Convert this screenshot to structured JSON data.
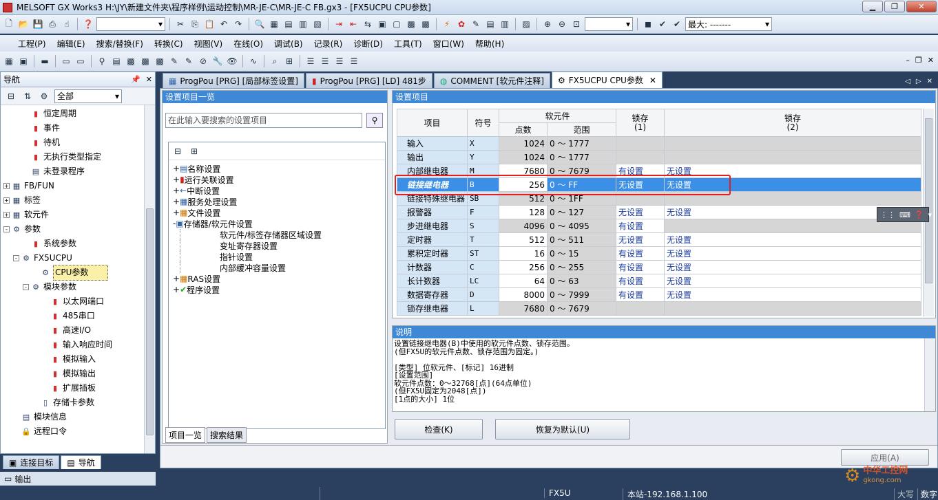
{
  "window": {
    "title": "MELSOFT GX Works3 H:\\JY\\新建文件夹\\程序样例\\运动控制\\MR-JE-C\\MR-JE-C FB.gx3 - [FX5UCPU CPU参数]"
  },
  "toolbar": {
    "max_label": "最大: -------"
  },
  "menu": [
    "工程(P)",
    "编辑(E)",
    "搜索/替换(F)",
    "转换(C)",
    "视图(V)",
    "在线(O)",
    "调试(B)",
    "记录(R)",
    "诊断(D)",
    "工具(T)",
    "窗口(W)",
    "帮助(H)"
  ],
  "nav": {
    "title": "导航",
    "filter": "全部",
    "items": [
      {
        "label": "恒定周期",
        "indent": 2,
        "exp": ""
      },
      {
        "label": "事件",
        "indent": 2,
        "exp": ""
      },
      {
        "label": "待机",
        "indent": 2,
        "exp": ""
      },
      {
        "label": "无执行类型指定",
        "indent": 2,
        "exp": ""
      },
      {
        "label": "未登录程序",
        "indent": 2,
        "exp": ""
      },
      {
        "label": "FB/FUN",
        "indent": 0,
        "exp": "+"
      },
      {
        "label": "标签",
        "indent": 0,
        "exp": "+"
      },
      {
        "label": "软元件",
        "indent": 0,
        "exp": "+"
      },
      {
        "label": "参数",
        "indent": 0,
        "exp": "-"
      },
      {
        "label": "系统参数",
        "indent": 2,
        "exp": ""
      },
      {
        "label": "FX5UCPU",
        "indent": 1,
        "exp": "-"
      },
      {
        "label": "CPU参数",
        "indent": 3,
        "exp": "",
        "selected": true
      },
      {
        "label": "模块参数",
        "indent": 2,
        "exp": "-"
      },
      {
        "label": "以太网端口",
        "indent": 4,
        "exp": ""
      },
      {
        "label": "485串口",
        "indent": 4,
        "exp": ""
      },
      {
        "label": "高速I/O",
        "indent": 4,
        "exp": ""
      },
      {
        "label": "输入响应时间",
        "indent": 4,
        "exp": ""
      },
      {
        "label": "模拟输入",
        "indent": 4,
        "exp": ""
      },
      {
        "label": "模拟输出",
        "indent": 4,
        "exp": ""
      },
      {
        "label": "扩展插板",
        "indent": 4,
        "exp": ""
      },
      {
        "label": "存储卡参数",
        "indent": 3,
        "exp": ""
      },
      {
        "label": "模块信息",
        "indent": 1,
        "exp": ""
      },
      {
        "label": "远程口令",
        "indent": 1,
        "exp": ""
      }
    ],
    "bottom_tabs": [
      "连接目标",
      "导航"
    ],
    "output": "输出"
  },
  "tabs": [
    "ProgPou [PRG] [局部标签设置]",
    "ProgPou [PRG] [LD] 481步",
    "COMMENT [软元件注释]",
    "FX5UCPU CPU参数"
  ],
  "left_panel": {
    "header": "设置项目一览",
    "search_placeholder": "在此输入要搜索的设置项目",
    "tree": [
      {
        "label": "名称设置",
        "level": 0,
        "exp": "+"
      },
      {
        "label": "运行关联设置",
        "level": 0,
        "exp": "+"
      },
      {
        "label": "中断设置",
        "level": 0,
        "exp": "+"
      },
      {
        "label": "服务处理设置",
        "level": 0,
        "exp": "+"
      },
      {
        "label": "文件设置",
        "level": 0,
        "exp": "+"
      },
      {
        "label": "存储器/软元件设置",
        "level": 0,
        "exp": "-"
      },
      {
        "label": "软元件/标签存储器区域设置",
        "level": 1,
        "exp": ""
      },
      {
        "label": "变址寄存器设置",
        "level": 1,
        "exp": ""
      },
      {
        "label": "指针设置",
        "level": 1,
        "exp": ""
      },
      {
        "label": "内部缓冲容量设置",
        "level": 1,
        "exp": ""
      },
      {
        "label": "RAS设置",
        "level": 0,
        "exp": "+"
      },
      {
        "label": "程序设置",
        "level": 0,
        "exp": "+"
      }
    ],
    "bottom_tabs": [
      "项目一览",
      "搜索结果"
    ]
  },
  "right_panel": {
    "header": "设置项目",
    "columns": {
      "item": "项目",
      "symbol": "符号",
      "device": "软元件",
      "points": "点数",
      "range": "范围",
      "latch1": "锁存\n(1)",
      "latch2": "锁存\n(2)"
    },
    "rows": [
      {
        "item": "输入",
        "sym": "X",
        "pts": "1024",
        "range": "0 ～ 1777",
        "l1": "",
        "l2": "",
        "gray": true
      },
      {
        "item": "输出",
        "sym": "Y",
        "pts": "1024",
        "range": "0 ～ 1777",
        "l1": "",
        "l2": "",
        "gray": true
      },
      {
        "item": "内部继电器",
        "sym": "M",
        "pts": "7680",
        "range": "0 ～ 7679",
        "l1": "有设置",
        "l2": "无设置"
      },
      {
        "item": "链接继电器",
        "sym": "B",
        "pts": "256",
        "range": "0 ～ FF",
        "l1": "无设置",
        "l2": "无设置",
        "hl": true
      },
      {
        "item": "链接特殊继电器",
        "sym": "SB",
        "pts": "512",
        "range": "0 ～ 1FF",
        "l1": "",
        "l2": "",
        "gray": true
      },
      {
        "item": "报警器",
        "sym": "F",
        "pts": "128",
        "range": "0 ～ 127",
        "l1": "无设置",
        "l2": "无设置"
      },
      {
        "item": "步进继电器",
        "sym": "S",
        "pts": "4096",
        "range": "0 ～ 4095",
        "l1": "有设置",
        "l2": "",
        "gray2": true
      },
      {
        "item": "定时器",
        "sym": "T",
        "pts": "512",
        "range": "0 ～ 511",
        "l1": "无设置",
        "l2": "无设置"
      },
      {
        "item": "累积定时器",
        "sym": "ST",
        "pts": "16",
        "range": "0 ～ 15",
        "l1": "有设置",
        "l2": "无设置"
      },
      {
        "item": "计数器",
        "sym": "C",
        "pts": "256",
        "range": "0 ～ 255",
        "l1": "有设置",
        "l2": "无设置"
      },
      {
        "item": "长计数器",
        "sym": "LC",
        "pts": "64",
        "range": "0 ～ 63",
        "l1": "有设置",
        "l2": "无设置"
      },
      {
        "item": "数据寄存器",
        "sym": "D",
        "pts": "8000",
        "range": "0 ～ 7999",
        "l1": "有设置",
        "l2": "无设置"
      },
      {
        "item": "锁存继电器",
        "sym": "L",
        "pts": "7680",
        "range": "0 ～ 7679",
        "l1": "",
        "l2": "",
        "gray": true
      }
    ]
  },
  "explanation": {
    "header": "说明",
    "lines": [
      "设置链接继电器(B)中使用的软元件点数、锁存范围。",
      "(但FX5U的软元件点数、锁存范围为固定。)",
      "",
      "[类型] 位软元件、[标记] 16进制",
      "[设置范围]",
      "软元件点数：0～32768[点](64点单位)",
      "(但FX5U固定为2048[点])",
      "[1点的大小] 1位"
    ]
  },
  "buttons": {
    "check": "检查(K)",
    "restore": "恢复为默认(U)",
    "apply": "应用(A)"
  },
  "status": {
    "cpu": "FX5U",
    "station": "本站-192.168.1.100",
    "caps": "大写",
    "num": "数字"
  },
  "watermark": {
    "text": "中华工控网",
    "url": "gkong.com"
  }
}
